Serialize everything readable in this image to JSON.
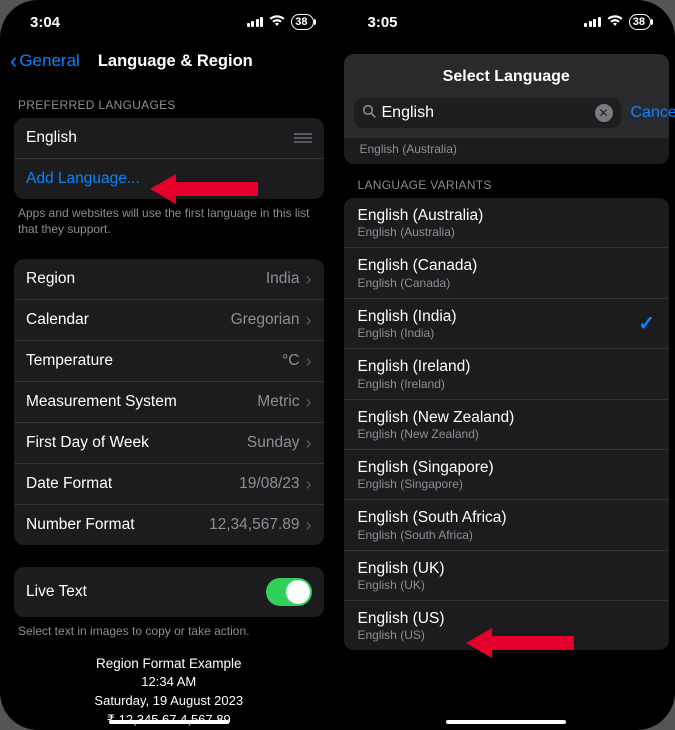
{
  "left": {
    "status": {
      "time": "3:04",
      "battery": "38"
    },
    "nav": {
      "back_label": "General",
      "title": "Language & Region"
    },
    "pref_header": "PREFERRED LANGUAGES",
    "pref_lang": "English",
    "add_language": "Add Language...",
    "pref_footer": "Apps and websites will use the first language in this list that they support.",
    "rows": {
      "region": {
        "label": "Region",
        "value": "India"
      },
      "calendar": {
        "label": "Calendar",
        "value": "Gregorian"
      },
      "temperature": {
        "label": "Temperature",
        "value": "°C"
      },
      "measurement": {
        "label": "Measurement System",
        "value": "Metric"
      },
      "firstday": {
        "label": "First Day of Week",
        "value": "Sunday"
      },
      "dateformat": {
        "label": "Date Format",
        "value": "19/08/23"
      },
      "numberformat": {
        "label": "Number Format",
        "value": "12,34,567.89"
      }
    },
    "livetext": {
      "label": "Live Text",
      "footer": "Select text in images to copy or take action."
    },
    "example": {
      "header": "Region Format Example",
      "time": "12:34 AM",
      "date": "Saturday, 19 August 2023",
      "money": "₹ 12,345.67    4,567.89"
    }
  },
  "right": {
    "status": {
      "time": "3:05",
      "battery": "38"
    },
    "title": "Select Language",
    "search_value": "English",
    "cancel": "Cancel",
    "partial": {
      "sub": "English (Australia)"
    },
    "section": "LANGUAGE VARIANTS",
    "variants": [
      {
        "main": "English (Australia)",
        "sub": "English (Australia)",
        "checked": false
      },
      {
        "main": "English (Canada)",
        "sub": "English (Canada)",
        "checked": false
      },
      {
        "main": "English (India)",
        "sub": "English (India)",
        "checked": true
      },
      {
        "main": "English (Ireland)",
        "sub": "English (Ireland)",
        "checked": false
      },
      {
        "main": "English (New Zealand)",
        "sub": "English (New Zealand)",
        "checked": false
      },
      {
        "main": "English (Singapore)",
        "sub": "English (Singapore)",
        "checked": false
      },
      {
        "main": "English (South Africa)",
        "sub": "English (South Africa)",
        "checked": false
      },
      {
        "main": "English (UK)",
        "sub": "English (UK)",
        "checked": false
      },
      {
        "main": "English (US)",
        "sub": "English (US)",
        "checked": false
      }
    ]
  }
}
